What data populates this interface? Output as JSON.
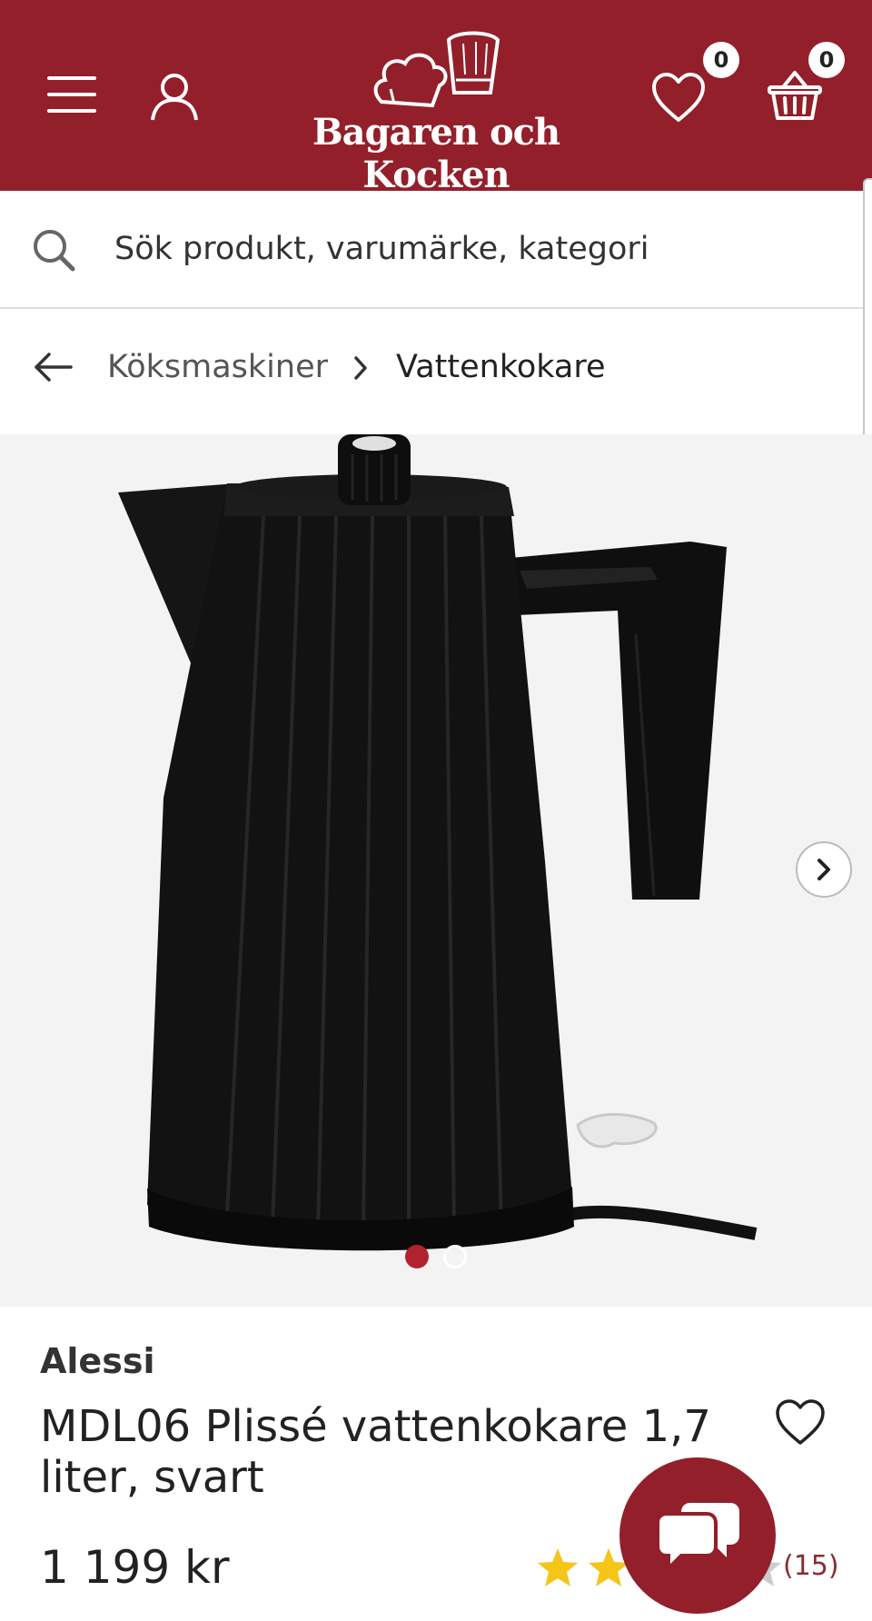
{
  "header": {
    "logo_text": "Bagaren och Kocken",
    "wishlist_count": "0",
    "cart_count": "0"
  },
  "search": {
    "placeholder": "Sök produkt, varumärke, kategori"
  },
  "breadcrumb": {
    "items": [
      "Köksmaskiner",
      "Vattenkokare"
    ]
  },
  "gallery": {
    "image_count": 2,
    "active_index": 0
  },
  "product": {
    "brand": "Alessi",
    "title": "MDL06 Plissé vattenkokare 1,7 liter, svart",
    "price": "1 199 kr",
    "rating": 4,
    "rating_max": 5,
    "review_count": "(15)"
  },
  "colors": {
    "brand_red": "#931f2a",
    "star_yellow": "#f5c518"
  }
}
